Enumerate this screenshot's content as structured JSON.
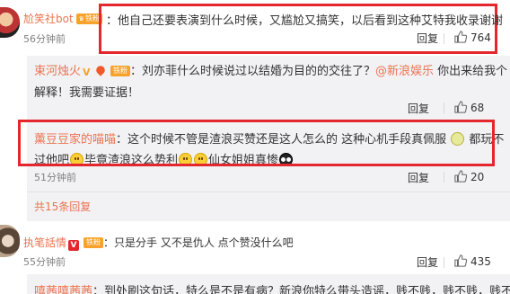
{
  "comment1": {
    "username": "尬笑社bot",
    "badge": "铁粉",
    "time": "56分钟前",
    "text": "：他自己还要表演到什么时候，又尴尬又搞笑，以后看到这种艾特我收录谢谢",
    "reply_label": "回复",
    "likes": "764"
  },
  "reply1": {
    "username": "束河烛火",
    "badge": "铁粉",
    "text_a": "：刘亦菲什么时候说过以结婚为目的的交往了？",
    "mention": "@新浪娱乐",
    "text_b": " 你出来给我个",
    "text_c": "解释！我需要证据！",
    "reply_label": "回复",
    "likes": "68"
  },
  "reply2": {
    "username": "薰豆豆家的喵喵",
    "text_a": "：这个时候不管是渣浪买赞还是这人怎么的  这种心机手段真佩服 ",
    "text_b": " 都玩不",
    "text_c": "过他吧",
    "text_d": "毕竟渣浪这么势利",
    "text_e": "仙女姐姐真惨",
    "time": "51分钟前",
    "reply_label": "回复",
    "likes": "20"
  },
  "more_replies": "共15条回复",
  "comment3": {
    "username": "执笔話情",
    "badge": "铁粉",
    "text": "：只是分手 又不是仇人 点个赞没什么吧",
    "time": "55分钟前",
    "reply_label": "回复",
    "likes": "435"
  },
  "reply3": {
    "username": "嘻茜嘻茜茜",
    "text": "：到处刷这句话，特么是不是有病？新浪你特么带头造谣，贱不贱，贱不贱，贱不"
  },
  "colors": {
    "accent": "#eb7350",
    "highlight_box": "#e4272c",
    "badge": "#f7a22b"
  },
  "icons": [
    "thumb-up-icon",
    "vip-v-icon",
    "fire-icon",
    "emoji-icon"
  ]
}
